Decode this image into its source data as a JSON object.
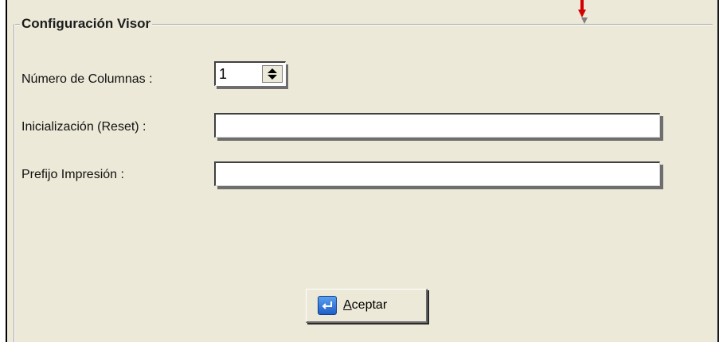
{
  "group": {
    "title": "Configuración Visor"
  },
  "fields": {
    "columns": {
      "label": "Número de Columnas :",
      "value": "1"
    },
    "reset": {
      "label": "Inicialización (Reset) :",
      "value": ""
    },
    "print_prefix": {
      "label": "Prefijo Impresión :",
      "value": ""
    }
  },
  "accept_button": {
    "label_mnemonic": "A",
    "label_rest": "ceptar",
    "icon": "enter-icon"
  },
  "colors": {
    "window_bg": "#ece9d8",
    "arrow": "#d40000"
  }
}
